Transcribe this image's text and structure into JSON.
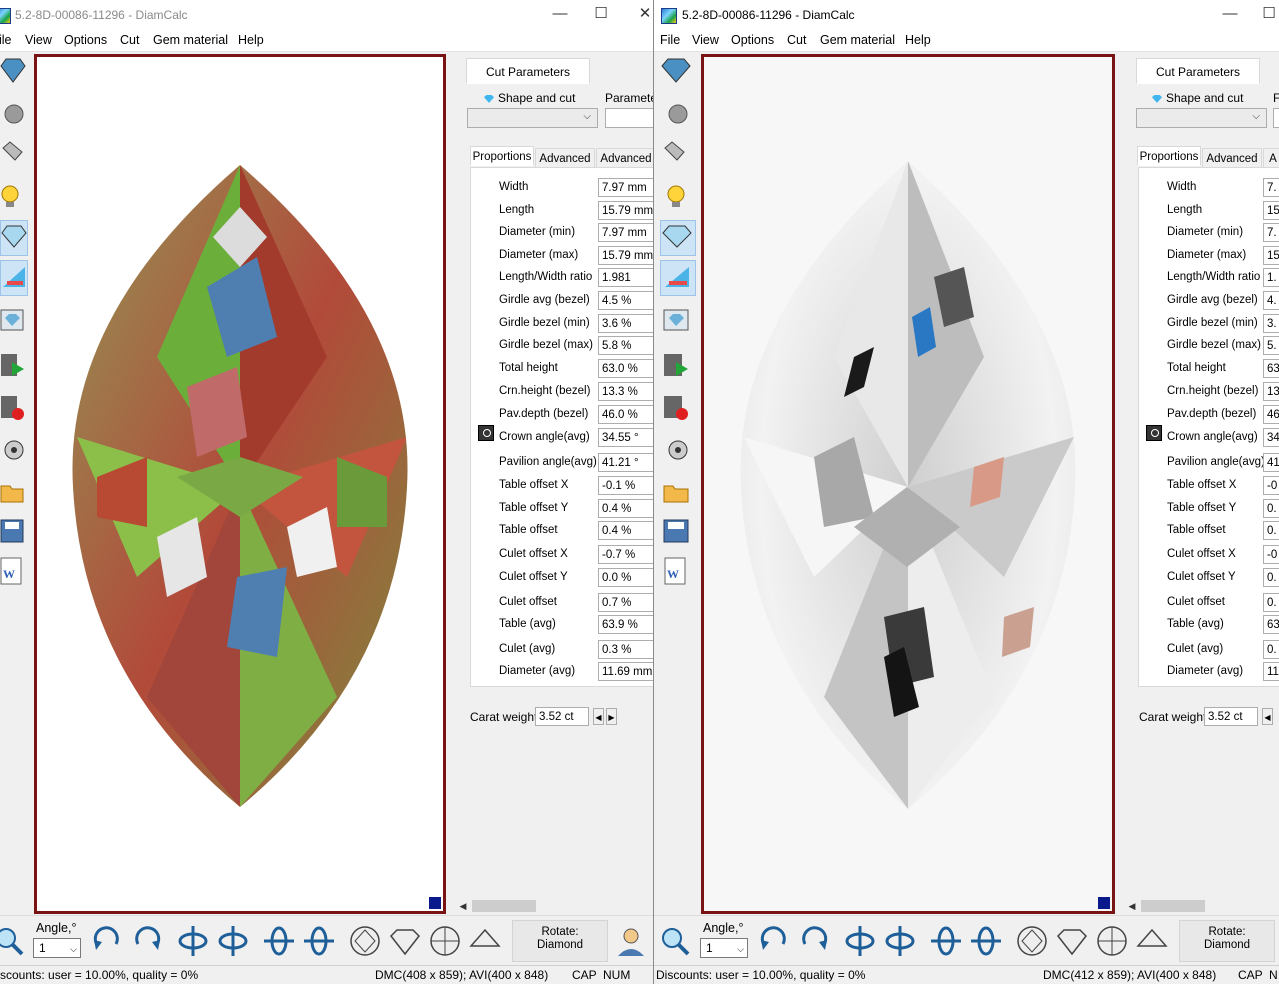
{
  "windows": [
    {
      "title": "5.2-8D-00086-11296 - DiamCalc",
      "menu": [
        "ile",
        "View",
        "Options",
        "Cut",
        "Gem material",
        "Help"
      ],
      "panel": {
        "tab": "Cut Parameters",
        "shape_label": "Shape and cut",
        "param_label": "Parameter",
        "subtabs": [
          "Proportions",
          "Advanced",
          "Advanced"
        ],
        "props": [
          {
            "label": "Width",
            "value": "7.97 mm"
          },
          {
            "label": "Length",
            "value": "15.79 mm"
          },
          {
            "label": "Diameter (min)",
            "value": "7.97 mm"
          },
          {
            "label": "Diameter (max)",
            "value": "15.79 mm"
          },
          {
            "label": "Length/Width ratio",
            "value": "1.981"
          },
          {
            "label": "Girdle avg (bezel)",
            "value": "4.5 %"
          },
          {
            "label": "Girdle bezel (min)",
            "value": "3.6 %"
          },
          {
            "label": "Girdle bezel (max)",
            "value": "5.8 %"
          },
          {
            "label": "Total height",
            "value": "63.0 %"
          },
          {
            "label": "Crn.height (bezel)",
            "value": "13.3 %"
          },
          {
            "label": "Pav.depth (bezel)",
            "value": "46.0 %"
          },
          {
            "label": "Crown angle(avg)",
            "value": "34.55 °"
          },
          {
            "label": "Pavilion angle(avg)",
            "value": "41.21 °"
          },
          {
            "label": "Table offset X",
            "value": "-0.1 %"
          },
          {
            "label": "Table offset Y",
            "value": "0.4 %"
          },
          {
            "label": "Table offset",
            "value": "0.4 %"
          },
          {
            "label": "Culet offset X",
            "value": "-0.7 %"
          },
          {
            "label": "Culet offset Y",
            "value": "0.0 %"
          },
          {
            "label": "Culet offset",
            "value": "0.7 %"
          },
          {
            "label": "Table (avg)",
            "value": "63.9 %"
          },
          {
            "label": "Culet (avg)",
            "value": "0.3 %"
          },
          {
            "label": "Diameter (avg)",
            "value": "11.69 mm"
          }
        ],
        "carat_label": "Carat weight",
        "carat_value": "3.52 ct"
      },
      "bottom": {
        "angle_label": "Angle,°",
        "angle_value": "1",
        "rotate_label": "Rotate:",
        "rotate_value": "Diamond"
      },
      "status": {
        "discounts": "scounts: user = 10.00%, quality = 0%",
        "dims": "DMC(408 x 859); AVI(400 x 848)",
        "cap": "CAP",
        "num": "NUM"
      }
    },
    {
      "title": "5.2-8D-00086-11296 - DiamCalc",
      "menu": [
        "File",
        "View",
        "Options",
        "Cut",
        "Gem material",
        "Help"
      ],
      "panel": {
        "tab": "Cut Parameters",
        "shape_label": "Shape and cut",
        "param_label": "F",
        "subtabs": [
          "Proportions",
          "Advanced",
          "A"
        ],
        "props": [
          {
            "label": "Width",
            "value": "7."
          },
          {
            "label": "Length",
            "value": "15"
          },
          {
            "label": "Diameter (min)",
            "value": "7."
          },
          {
            "label": "Diameter (max)",
            "value": "15"
          },
          {
            "label": "Length/Width ratio",
            "value": "1."
          },
          {
            "label": "Girdle avg (bezel)",
            "value": "4."
          },
          {
            "label": "Girdle bezel (min)",
            "value": "3."
          },
          {
            "label": "Girdle bezel (max)",
            "value": "5."
          },
          {
            "label": "Total height",
            "value": "63"
          },
          {
            "label": "Crn.height (bezel)",
            "value": "13"
          },
          {
            "label": "Pav.depth (bezel)",
            "value": "46"
          },
          {
            "label": "Crown angle(avg)",
            "value": "34"
          },
          {
            "label": "Pavilion angle(avg)",
            "value": "41"
          },
          {
            "label": "Table offset X",
            "value": "-0"
          },
          {
            "label": "Table offset Y",
            "value": "0."
          },
          {
            "label": "Table offset",
            "value": "0."
          },
          {
            "label": "Culet offset X",
            "value": "-0"
          },
          {
            "label": "Culet offset Y",
            "value": "0."
          },
          {
            "label": "Culet offset",
            "value": "0."
          },
          {
            "label": "Table (avg)",
            "value": "63"
          },
          {
            "label": "Culet (avg)",
            "value": "0."
          },
          {
            "label": "Diameter (avg)",
            "value": "11"
          }
        ],
        "carat_label": "Carat weight",
        "carat_value": "3.52 ct"
      },
      "bottom": {
        "angle_label": "Angle,°",
        "angle_value": "1",
        "rotate_label": "Rotate:",
        "rotate_value": "Diamond"
      },
      "status": {
        "discounts": "Discounts: user = 10.00%, quality = 0%",
        "dims": "DMC(412 x 859); AVI(400 x 848)",
        "cap": "CAP",
        "num": "N"
      }
    }
  ],
  "colors": {
    "viewer_border": "#7a1414",
    "corner_marker": "#0a1a8c",
    "active_tool": "#cde4f7"
  },
  "toolbar_icons": [
    "diamond-view-icon",
    "sphere-icon",
    "paint-bucket-icon",
    "light-bulb-icon",
    "sparkle-diamond-icon",
    "spectrum-icon",
    "diamond-image-icon",
    "video-play-icon",
    "video-record-icon",
    "reel-icon",
    "open-folder-icon",
    "save-disk-icon",
    "word-document-icon"
  ],
  "bottom_icons": [
    "zoom-icon",
    "rotate-cw-icon",
    "rotate-ccw-icon",
    "flip-vertical-icon",
    "flip-vertical-2-icon",
    "flip-horizontal-icon",
    "flip-horizontal-2-icon",
    "top-view-icon",
    "side-view-icon",
    "bottom-view-icon",
    "profile-view-icon"
  ]
}
